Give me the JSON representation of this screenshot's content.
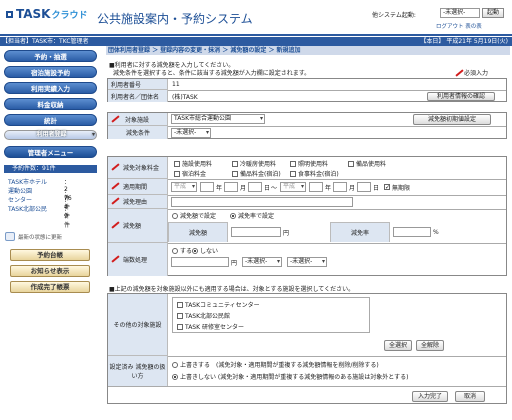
{
  "header": {
    "logo": "TASK",
    "logo_suffix": "クラウド",
    "system_title": "公共施設案内・予約システム",
    "system_start_label": "他システム起動:",
    "system_select": "-未選択-",
    "start_button": "起動",
    "links": "ログアウト 表の表"
  },
  "bar": {
    "left": "【担当者】TASK市：TKC管理者",
    "right": "【本日】 平成21年 5月19日(火)"
  },
  "sidebar": {
    "items": [
      {
        "label": "予約・抽選"
      },
      {
        "label": "宿泊施設予約"
      },
      {
        "label": "利用実績入力"
      },
      {
        "label": "料金収納"
      },
      {
        "label": "統計"
      },
      {
        "label": "利用者登録"
      },
      {
        "label": "管理者メニュー"
      }
    ],
    "reservation_header": "予約件数：91件",
    "reservation_rows": [
      {
        "name": "TASK市ホテル",
        "count": "：2件"
      },
      {
        "name": "運動公園",
        "count": "：76件"
      },
      {
        "name": "センター",
        "count": "：4件"
      },
      {
        "name": "TASK北部公民",
        "count": "：9件"
      }
    ],
    "refresh_label": "最新の状態に更新",
    "bottom_buttons": [
      {
        "label": "予約台帳"
      },
      {
        "label": "お知らせ表示"
      },
      {
        "label": "作成完了帳票"
      }
    ]
  },
  "breadcrumb": "団体利用者登録 ＞ 登録内容の変更・抹消 ＞ 減免額の設定 ＞ 新規追加",
  "notes": {
    "line1": "■利用者に対する減免額を入力してください。",
    "line2": "減免条件を選択すると、条件に該当する減免額が入力欄に設定されます。",
    "required": "必須入力",
    "section2": "■上記の減免額を対象施設以外にも適用する場合は、対象とする施設を選択してください。"
  },
  "user": {
    "number_label": "利用者番号",
    "number_value": "11",
    "name_label": "利用者名／団体名",
    "name_value": "(株)TASK",
    "info_button": "利用者情報の確認"
  },
  "target": {
    "facility_label": "対象施設",
    "facility_value": "TASK市総合運動公園",
    "init_button": "減免額初期値設定",
    "condition_label": "減免条件",
    "condition_value": "-未選択-"
  },
  "fees": {
    "label": "減免対象料金",
    "items": [
      {
        "label": "施設使用料",
        "checked": false
      },
      {
        "label": "冷暖房使用料",
        "checked": false
      },
      {
        "label": "照明使用料",
        "checked": false
      },
      {
        "label": "備品使用料",
        "checked": false
      },
      {
        "label": "宿泊料金",
        "checked": false
      },
      {
        "label": "備品料金(宿泊)",
        "checked": false
      },
      {
        "label": "食事料金(宿泊)",
        "checked": false
      }
    ]
  },
  "period": {
    "label": "適用期間",
    "era_from": "平成",
    "year": "年",
    "month": "月",
    "day": "日",
    "tilde": "～",
    "era_to": "平成",
    "unlimited": "無期限",
    "unlimited_checked": true
  },
  "reason": {
    "label": "減免理由",
    "value": ""
  },
  "amount": {
    "label": "減免額",
    "radio_amount": "減免額で設定",
    "radio_rate": "減免率で設定",
    "selected": "rate",
    "amount_label": "減免額",
    "amount_unit": "円",
    "rate_label": "減免率",
    "rate_unit": "%"
  },
  "rounding": {
    "label": "端数処理",
    "yes": "する",
    "no": "しない",
    "selected": "no",
    "unit": "円",
    "select1": "-未選択-",
    "select2": "-未選択-"
  },
  "other": {
    "label": "その他の対象施設",
    "facilities": [
      {
        "label": "TASKコミュニティセンター"
      },
      {
        "label": "TASK北部公民館"
      },
      {
        "label": "TASK 研修室センター"
      }
    ],
    "select_all": "全選択",
    "clear_all": "全解除"
  },
  "existing": {
    "label": "設定済み 減免額の扱い方",
    "option1": "上書きする　(減免対象・適用期間が重複する減免額情報を削除/削除する)",
    "option2": "上書きしない (減免対象・適用期間が重複する減免額情報のある施設は対象外とする)",
    "selected": "no"
  },
  "footer": {
    "complete": "入力完了",
    "cancel": "取消"
  },
  "colors": {
    "accent": "#2c5aa0",
    "required": "#d21d1d"
  }
}
